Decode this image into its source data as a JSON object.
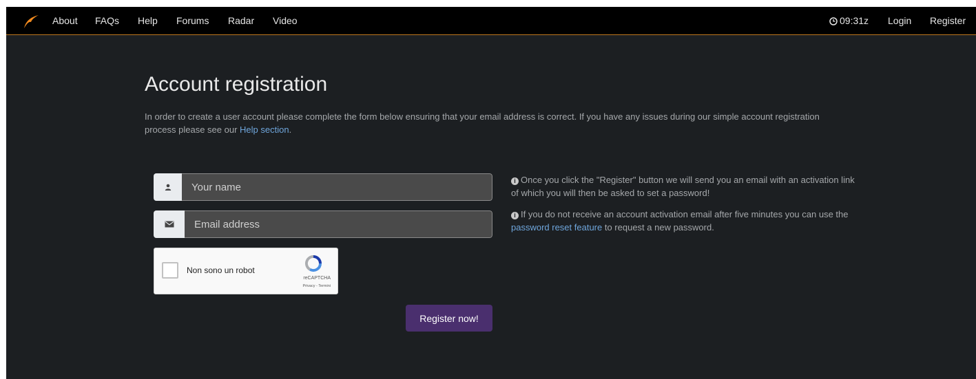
{
  "nav": {
    "items": [
      "About",
      "FAQs",
      "Help",
      "Forums",
      "Radar",
      "Video"
    ],
    "time": "09:31z",
    "login": "Login",
    "register": "Register"
  },
  "page": {
    "title": "Account registration",
    "intro_text": "In order to create a user account please complete the form below ensuring that your email address is correct. If you have any issues during our simple account registration process please see our ",
    "intro_link": "Help section",
    "intro_end": "."
  },
  "form": {
    "name_placeholder": "Your name",
    "email_placeholder": "Email address",
    "submit_label": "Register now!"
  },
  "captcha": {
    "label": "Non sono un robot",
    "brand": "reCAPTCHA",
    "links": "Privacy - Termini"
  },
  "info": {
    "line1": "Once you click the \"Register\" button we will send you an email with an activation link of which you will then be asked to set a password!",
    "line2_start": "If you do not receive an account activation email after five minutes you can use the ",
    "line2_link": "password reset feature",
    "line2_end": " to request a new password."
  },
  "icons": {
    "logo": "flame-logo",
    "clock": "clock-icon",
    "name": "user-icon",
    "email": "envelope-icon",
    "info": "info-circle-icon",
    "captcha": "recaptcha-logo"
  },
  "colors": {
    "background": "#1c1f22",
    "navbar": "#000000",
    "accent_line": "#c0781e",
    "link": "#6fa6dc",
    "button": "#4a2f6e"
  }
}
